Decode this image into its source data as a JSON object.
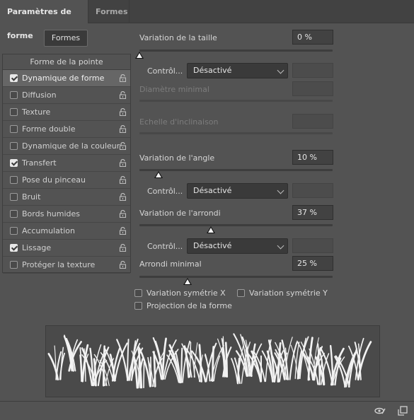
{
  "tabs": [
    {
      "label": "Paramètres de forme",
      "active": true
    },
    {
      "label": "Formes",
      "active": false
    }
  ],
  "formes_button": "Formes",
  "list": {
    "header": "Forme de la pointe",
    "items": [
      {
        "label": "Dynamique de forme",
        "checked": true,
        "selected": true
      },
      {
        "label": "Diffusion",
        "checked": false,
        "selected": false
      },
      {
        "label": "Texture",
        "checked": false,
        "selected": false
      },
      {
        "label": "Forme double",
        "checked": false,
        "selected": false
      },
      {
        "label": "Dynamique de la couleur",
        "checked": false,
        "selected": false
      },
      {
        "label": "Transfert",
        "checked": true,
        "selected": false
      },
      {
        "label": "Pose du pinceau",
        "checked": false,
        "selected": false
      },
      {
        "label": "Bruit",
        "checked": false,
        "selected": false
      },
      {
        "label": "Bords humides",
        "checked": false,
        "selected": false
      },
      {
        "label": "Accumulation",
        "checked": false,
        "selected": false
      },
      {
        "label": "Lissage",
        "checked": true,
        "selected": false
      },
      {
        "label": "Protéger la texture",
        "checked": false,
        "selected": false
      }
    ]
  },
  "size_variation": {
    "label": "Variation de la taille",
    "value": "0 %",
    "level": 0
  },
  "control1": {
    "label": "Contrôl...",
    "value": "Désactivé"
  },
  "min_diameter": {
    "label": "Diamètre minimal"
  },
  "tilt_scale": {
    "label": "Echelle d'inclinaison"
  },
  "angle_variation": {
    "label": "Variation de l'angle",
    "value": "10 %",
    "level": 10
  },
  "control2": {
    "label": "Contrôl...",
    "value": "Désactivé"
  },
  "roundness_variation": {
    "label": "Variation de l'arrondi",
    "value": "37 %",
    "level": 37
  },
  "control3": {
    "label": "Contrôl...",
    "value": "Désactivé"
  },
  "min_roundness": {
    "label": "Arrondi minimal",
    "value": "25 %",
    "level": 25
  },
  "options": {
    "sym_x": "Variation symétrie X",
    "sym_y": "Variation symétrie Y",
    "projection": "Projection de la forme"
  },
  "colors": {
    "panel": "#535353",
    "field": "#424242",
    "selected_row": "#666666"
  },
  "footer_icons": [
    "eye-brush-icon",
    "new-preset-icon"
  ]
}
